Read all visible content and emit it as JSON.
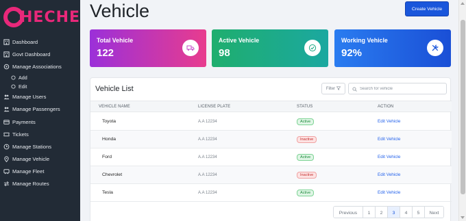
{
  "brand": {
    "name": "HECHE",
    "color": "#e8287a"
  },
  "sidebar": {
    "items": [
      {
        "label": "Dashboard",
        "icon": "building-icon"
      },
      {
        "label": "Govt Dashboard",
        "icon": "building-icon"
      },
      {
        "label": "Manage Associations",
        "icon": "gear-icon"
      },
      {
        "label": "Add",
        "icon": "circle-icon"
      },
      {
        "label": "Edit",
        "icon": "circle-icon"
      },
      {
        "label": "Manage Users",
        "icon": "users-icon"
      },
      {
        "label": "Manage Passengers",
        "icon": "users-icon"
      },
      {
        "label": "Payments",
        "icon": "card-icon"
      },
      {
        "label": "Tickets",
        "icon": "ticket-icon"
      },
      {
        "label": "Manage Stations",
        "icon": "clock-icon"
      },
      {
        "label": "Manage Vehicle",
        "icon": "pin-icon"
      },
      {
        "label": "Manage Fleet",
        "icon": "fleet-icon"
      },
      {
        "label": "Manage Routes",
        "icon": "arrows-icon"
      }
    ]
  },
  "header": {
    "title": "Vehicle",
    "create_label": "Create Vehicle"
  },
  "cards": {
    "total": {
      "label": "Total Vehicle",
      "value": "122",
      "icon": "truck-icon"
    },
    "active": {
      "label": "Active Vehicle",
      "value": "98",
      "icon": "check-circle-icon"
    },
    "working": {
      "label": "Working Vehicle",
      "value": "92%",
      "icon": "tools-icon"
    }
  },
  "list": {
    "title": "Vehicle List",
    "filter_label": "Filter",
    "search_placeholder": "Search for vehicle",
    "columns": [
      "VEHICLE NAME",
      "LICENSE PLATE",
      "STATUS",
      "ACTION"
    ],
    "rows": [
      {
        "name": "Toyota",
        "plate": "A.A 12234",
        "status": "Active",
        "action": "Edit Vehicle"
      },
      {
        "name": "Honda",
        "plate": "A.A 12234",
        "status": "Inactive",
        "action": "Edit Vehicle"
      },
      {
        "name": "Ford",
        "plate": "A.A 12234",
        "status": "Active",
        "action": "Edit Vehicle"
      },
      {
        "name": "Chevrolet",
        "plate": "A.A 12234",
        "status": "Inactive",
        "action": "Edit Vehicle"
      },
      {
        "name": "Tesla",
        "plate": "A.A 12234",
        "status": "Active",
        "action": "Edit Vehicle"
      }
    ]
  },
  "pagination": {
    "previous": "Previous",
    "pages": [
      "1",
      "2",
      "3",
      "4",
      "5"
    ],
    "current": "3",
    "next": "Next"
  }
}
